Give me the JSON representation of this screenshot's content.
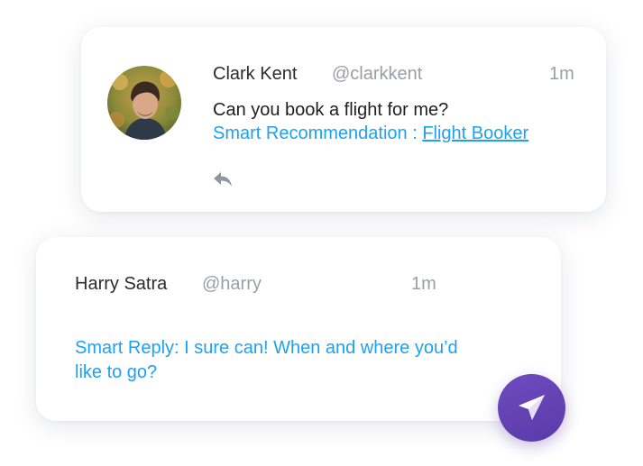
{
  "incoming": {
    "name": "Clark Kent",
    "handle": "@clarkkent",
    "time": "1m",
    "message": "Can you book a flight for me?",
    "recommendation_prefix": "Smart Recommendation : ",
    "recommendation_link": "Flight Booker",
    "reply_icon": "reply-icon",
    "avatar_icon": "avatar"
  },
  "outgoing": {
    "name": "Harry Satra",
    "handle": "@harry",
    "time": "1m",
    "smart_reply": "Smart Reply: I sure can! When and where you’d like to go?",
    "send_icon": "send-icon"
  },
  "colors": {
    "accent_blue": "#1da1f2",
    "send_purple": "#5f3fb0",
    "muted_gray": "#9a9ea6",
    "text_dark": "#2b2b2b"
  }
}
